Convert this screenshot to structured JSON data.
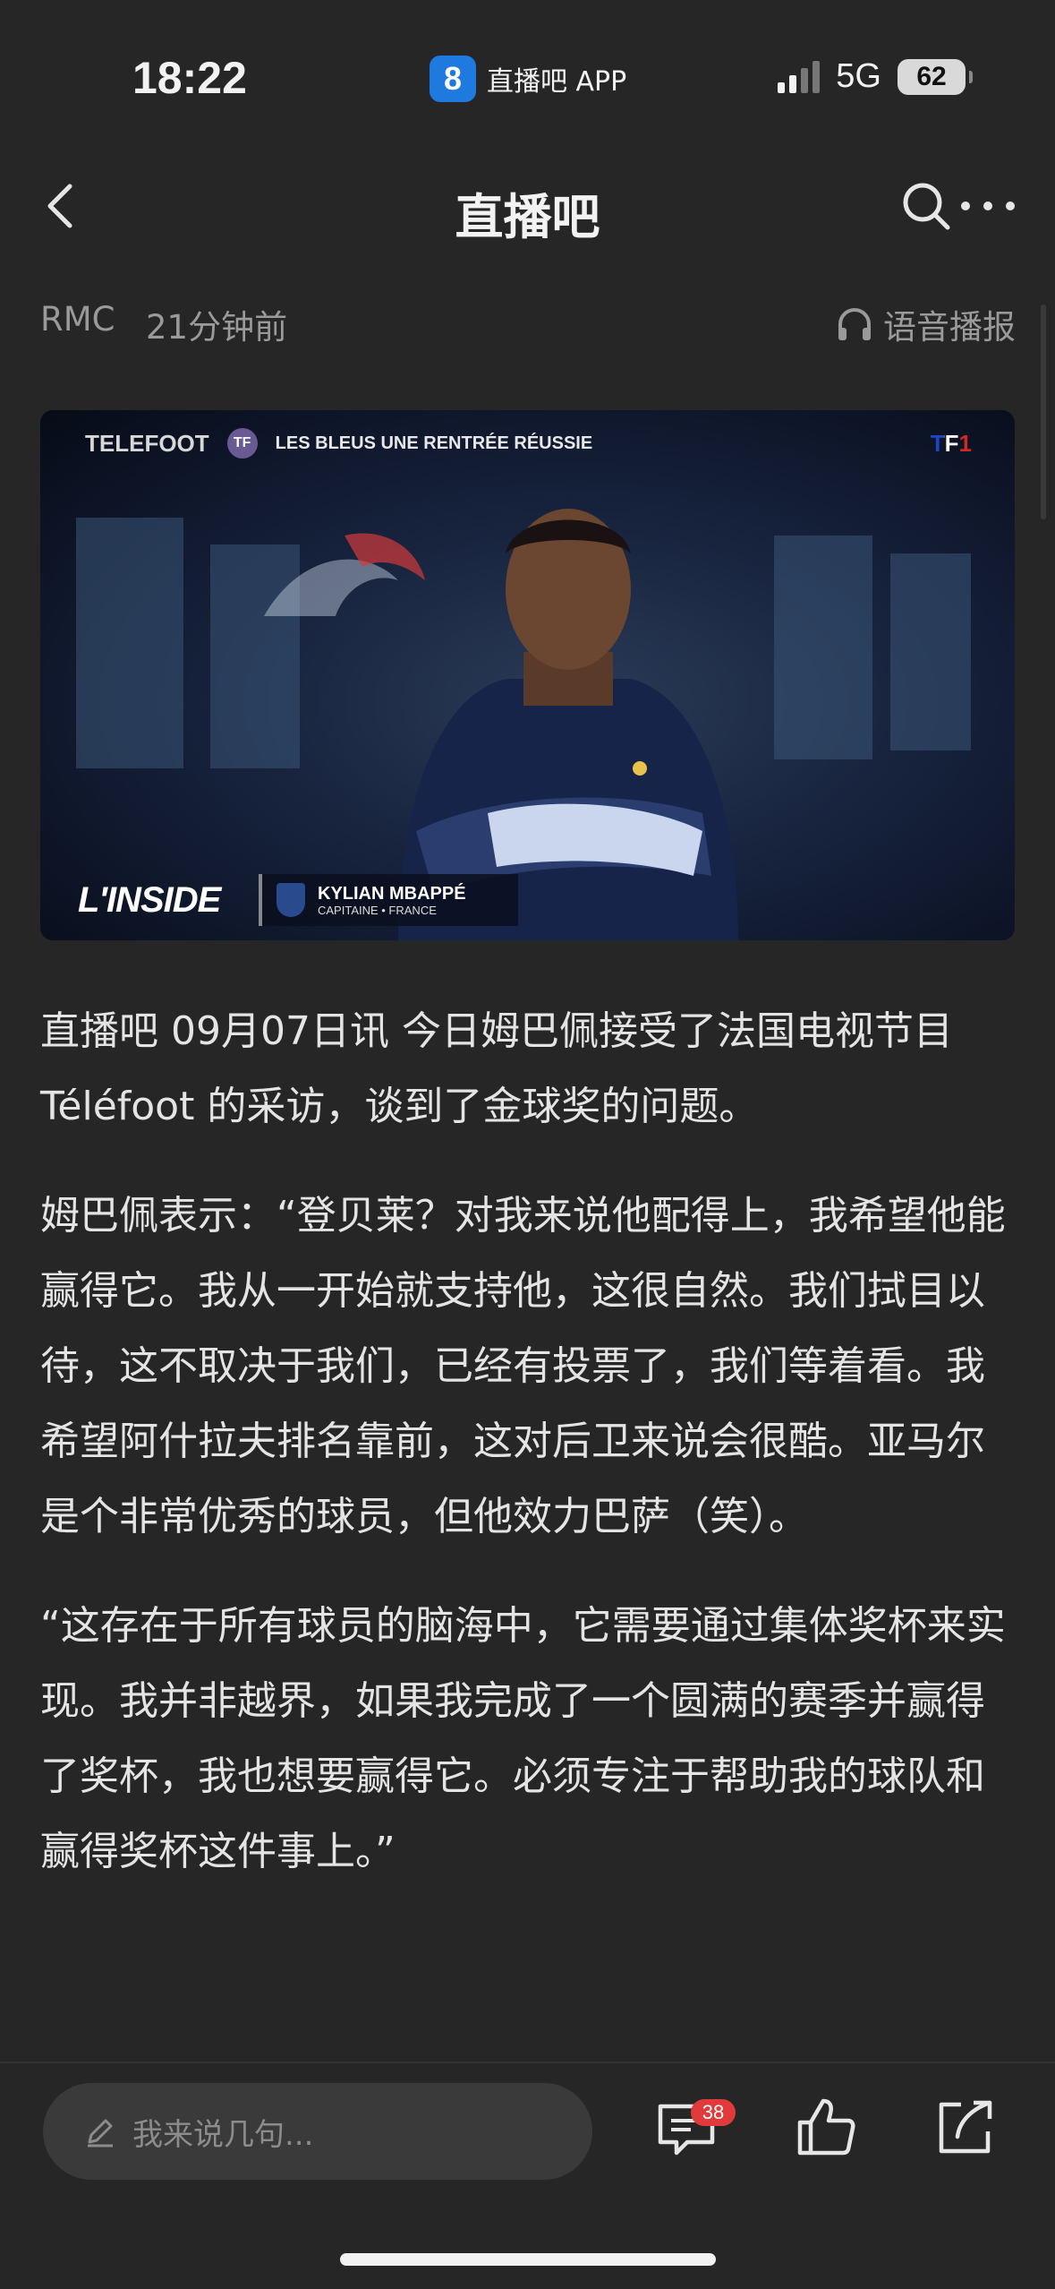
{
  "status_bar": {
    "time": "18:22",
    "app_logo": "8",
    "app_name": "直播吧 APP",
    "network": "5G",
    "battery": "62"
  },
  "nav": {
    "title": "直播吧",
    "back_icon": "chevron-left-icon",
    "search_icon": "search-icon",
    "more_icon": "more-dots-icon"
  },
  "meta": {
    "source": "RMC",
    "time_ago": "21分钟前",
    "audio_label": "语音播报"
  },
  "hero": {
    "brand": "TELEFOOT",
    "badge": "TF",
    "headline": "LES BLEUS UNE RENTRÉE RÉUSSIE",
    "channel": "TF1",
    "segment": "L'INSIDE",
    "caption_name": "KYLIAN MBAPPÉ",
    "caption_role": "CAPITAINE • FRANCE"
  },
  "article": {
    "paragraphs": [
      "直播吧 09月07日讯   今日姆巴佩接受了法国电视节目 Téléfoot 的采访，谈到了金球奖的问题。",
      "姆巴佩表示：“登贝莱？对我来说他配得上，我希望他能赢得它。我从一开始就支持他，这很自然。我们拭目以待，这不取决于我们，已经有投票了，我们等着看。我希望阿什拉夫排名靠前，这对后卫来说会很酷。亚马尔是个非常优秀的球员，但他效力巴萨（笑）。",
      "“这存在于所有球员的脑海中，它需要通过集体奖杯来实现。我并非越界，如果我完成了一个圆满的赛季并赢得了奖杯，我也想要赢得它。必须专注于帮助我的球队和赢得奖杯这件事上。”"
    ]
  },
  "bottom_bar": {
    "comment_placeholder": "我来说几句...",
    "comment_count": "38"
  },
  "colors": {
    "background": "#262626",
    "text": "#e4e4e4",
    "muted": "#9a9a9a",
    "badge_red": "#e03a3a"
  }
}
